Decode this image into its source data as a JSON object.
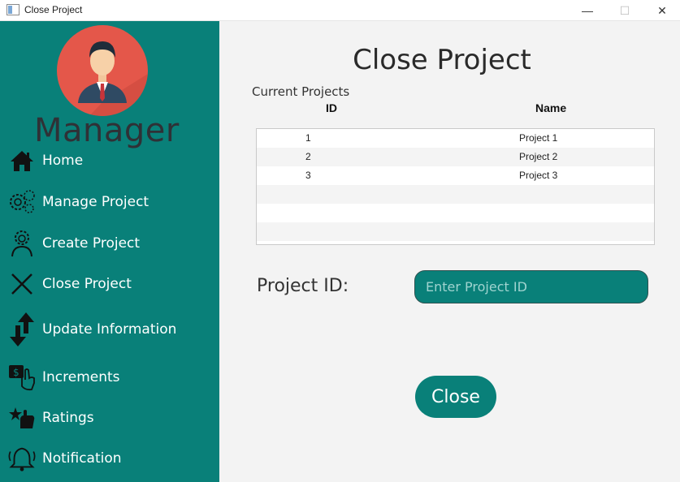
{
  "window": {
    "title": "Close Project",
    "minimize_glyph": "—",
    "maximize_glyph": "☐",
    "close_glyph": "✕"
  },
  "sidebar": {
    "role": "Manager",
    "items": [
      {
        "label": "Home",
        "icon": "home-icon"
      },
      {
        "label": "Manage Project",
        "icon": "gears-icon"
      },
      {
        "label": "Create Project",
        "icon": "person-gear-icon"
      },
      {
        "label": "Close Project",
        "icon": "x-icon"
      },
      {
        "label": "Update Information",
        "icon": "up-down-arrows-icon"
      },
      {
        "label": "Increments",
        "icon": "money-hand-icon"
      },
      {
        "label": "Ratings",
        "icon": "star-hand-icon"
      },
      {
        "label": "Notification",
        "icon": "bell-icon"
      }
    ]
  },
  "main": {
    "title": "Close Project",
    "section_label": "Current Projects",
    "columns": {
      "id": "ID",
      "name": "Name"
    },
    "rows": [
      {
        "id": "1",
        "name": "Project 1"
      },
      {
        "id": "2",
        "name": "Project 2"
      },
      {
        "id": "3",
        "name": "Project 3"
      }
    ],
    "project_id_label": "Project ID:",
    "project_id_value": "",
    "project_id_placeholder": "Enter Project ID",
    "close_button": "Close"
  },
  "colors": {
    "sidebar": "#098079",
    "accent": "#098079",
    "avatar": "#e4574a",
    "background": "#f3f3f3"
  }
}
